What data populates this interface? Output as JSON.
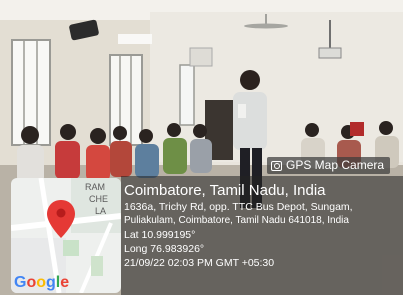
{
  "badge": {
    "label": "GPS Map Camera",
    "icon": "camera-icon"
  },
  "location": {
    "title": "Coimbatore, Tamil Nadu, India",
    "address_line1": "1636a, Trichy Rd, opp. TTC Bus Depot, Sungam,",
    "address_line2": "Puliakulam, Coimbatore, Tamil Nadu 641018, India",
    "lat": "Lat 10.999195°",
    "long": "Long 76.983926°",
    "datetime": "21/09/22 02:03 PM GMT +05:30"
  },
  "map": {
    "label_fragments": [
      "RAM",
      "CHE",
      "LA"
    ],
    "logo": "Google",
    "pin_icon": "map-pin-icon",
    "pin_color": "#e53935"
  }
}
